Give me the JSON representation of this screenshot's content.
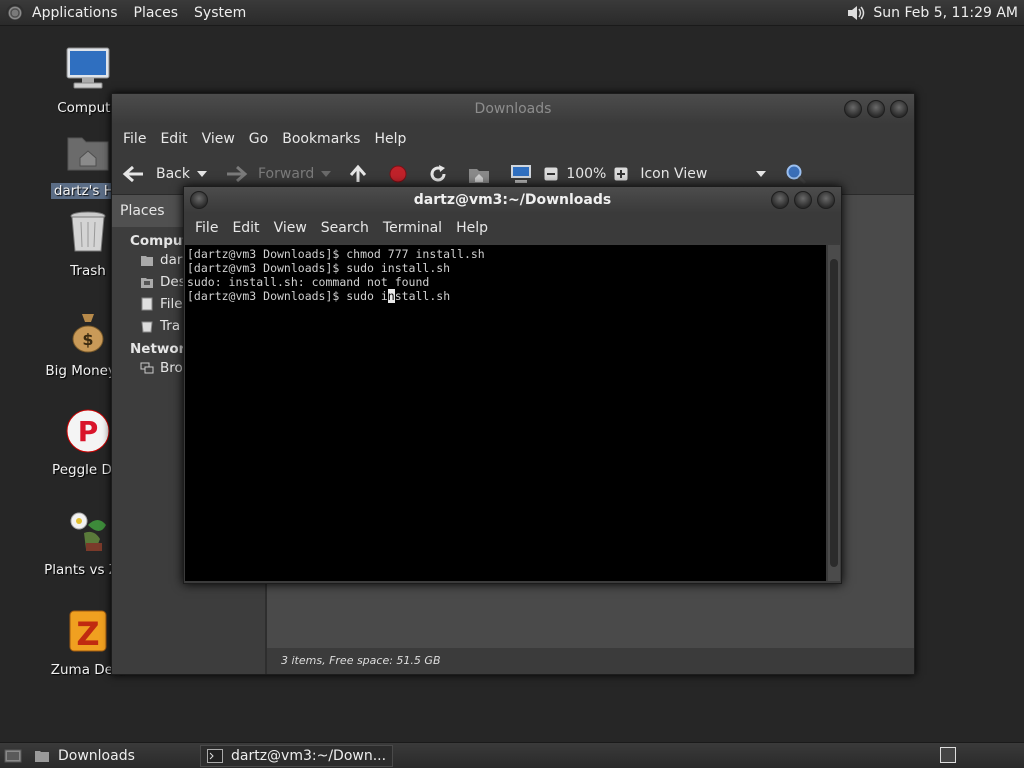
{
  "top_panel": {
    "menus": [
      "Applications",
      "Places",
      "System"
    ],
    "clock": "Sun Feb  5, 11:29 AM"
  },
  "desktop_icons": [
    {
      "label": "Compute",
      "icon": "computer-icon"
    },
    {
      "label": "dartz's Ho",
      "icon": "home-folder-icon",
      "selected": true
    },
    {
      "label": "Trash",
      "icon": "trash-icon"
    },
    {
      "label": "Big Money D",
      "icon": "money-bag-icon"
    },
    {
      "label": "Peggle Del",
      "icon": "peggle-icon"
    },
    {
      "label": "Plants vs Zor",
      "icon": "plants-vs-zombies-icon"
    },
    {
      "label": "Zuma Delu",
      "icon": "zuma-icon"
    }
  ],
  "nautilus": {
    "title": "Downloads",
    "menus": [
      "File",
      "Edit",
      "View",
      "Go",
      "Bookmarks",
      "Help"
    ],
    "toolbar": {
      "back": "Back",
      "forward": "Forward",
      "zoom": "100%",
      "view_mode": "Icon View"
    },
    "sidebar": {
      "header": "Places",
      "computer_heading": "Compute",
      "items": [
        "dar",
        "Des",
        "File",
        "Tra"
      ],
      "network_heading": "Network",
      "network_items": [
        "Bro"
      ]
    },
    "status": "3 items, Free space: 51.5 GB"
  },
  "terminal": {
    "title": "dartz@vm3:~/Downloads",
    "menus": [
      "File",
      "Edit",
      "View",
      "Search",
      "Terminal",
      "Help"
    ],
    "lines": [
      "[dartz@vm3 Downloads]$ chmod 777 install.sh",
      "[dartz@vm3 Downloads]$ sudo install.sh",
      "sudo: install.sh: command not found"
    ],
    "prompt_before_cursor": "[dartz@vm3 Downloads]$ sudo i",
    "cursor_char": "n",
    "prompt_after_cursor": "stall.sh"
  },
  "taskbar": {
    "tasks": [
      "Downloads",
      "dartz@vm3:~/Down..."
    ]
  }
}
